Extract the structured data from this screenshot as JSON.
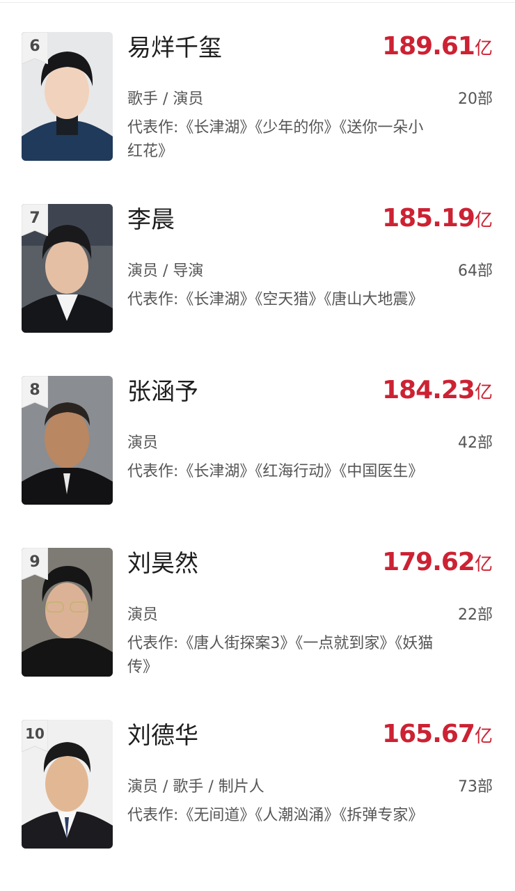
{
  "ranking": [
    {
      "rank": "6",
      "name": "易烊千玺",
      "box_office": "189.61",
      "unit": "亿",
      "roles": "歌手 / 演员",
      "film_count": "20部",
      "works": "代表作:《长津湖》《少年的你》《送你一朵小红花》"
    },
    {
      "rank": "7",
      "name": "李晨",
      "box_office": "185.19",
      "unit": "亿",
      "roles": "演员 / 导演",
      "film_count": "64部",
      "works": "代表作:《长津湖》《空天猎》《唐山大地震》"
    },
    {
      "rank": "8",
      "name": "张涵予",
      "box_office": "184.23",
      "unit": "亿",
      "roles": "演员",
      "film_count": "42部",
      "works": "代表作:《长津湖》《红海行动》《中国医生》"
    },
    {
      "rank": "9",
      "name": "刘昊然",
      "box_office": "179.62",
      "unit": "亿",
      "roles": "演员",
      "film_count": "22部",
      "works": "代表作:《唐人街探案3》《一点就到家》《妖猫传》"
    },
    {
      "rank": "10",
      "name": "刘德华",
      "box_office": "165.67",
      "unit": "亿",
      "roles": "演员 / 歌手 / 制片人",
      "film_count": "73部",
      "works": "代表作:《无间道》《人潮汹涌》《拆弹专家》"
    }
  ],
  "colors": {
    "box_office": "#cc2233",
    "rank_badge": "#f2f2f2"
  }
}
